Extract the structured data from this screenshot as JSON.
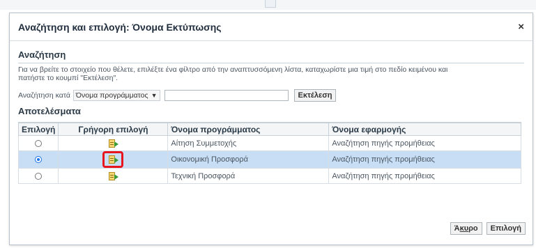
{
  "dialog": {
    "title": "Αναζήτηση και επιλογή: Όνομα Εκτύπωσης",
    "close_icon": "×"
  },
  "search": {
    "heading": "Αναζήτηση",
    "instruction_line1": "Για να βρείτε το στοιχείο που θέλετε, επιλέξτε ένα φίλτρο από την αναπτυσσόμενη λίστα, καταχωρίστε μια τιμή στο πεδίο κειμένου και",
    "instruction_line2": "πατήστε το κουμπί \"Εκτέλεση\".",
    "by_label": "Αναζήτηση κατά",
    "selected_filter": "Όνομα προγράμματος",
    "input_value": "",
    "go_label": "Εκτέλεση"
  },
  "results": {
    "heading": "Αποτελέσματα",
    "columns": [
      "Επιλογή",
      "Γρήγορη επιλογή",
      "Όνομα προγράμματος",
      "Όνομα εφαρμογής"
    ],
    "rows": [
      {
        "selected": false,
        "program": "Αίτηση Συμμετοχής",
        "application": "Αναζήτηση πηγής προμήθειας"
      },
      {
        "selected": true,
        "program": "Οικονομική Προσφορά",
        "application": "Αναζήτηση πηγής προμήθειας"
      },
      {
        "selected": false,
        "program": "Τεχνική Προσφορά",
        "application": "Αναζήτηση πηγής προμήθειας"
      }
    ]
  },
  "buttons": {
    "cancel_prefix": "Ά",
    "cancel_underlined": "κυ",
    "cancel_suffix": "ρο",
    "select": "Επιλογή"
  },
  "colors": {
    "selected_row": "#c8def5",
    "highlight": "#e8141e",
    "radio_on": "#1a73e8"
  },
  "icons": {
    "quick_select": "quick-select-icon",
    "dropdown": "chevron-down-icon"
  }
}
